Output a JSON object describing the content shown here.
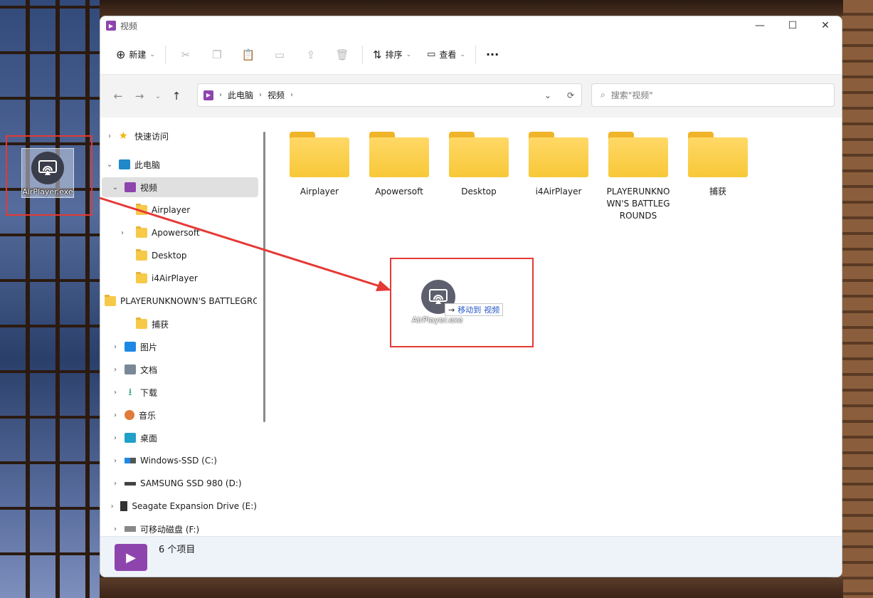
{
  "desktop": {
    "icon_label": "AirPlayer.exe"
  },
  "window": {
    "title": "视频",
    "min": "—",
    "max": "☐",
    "close": "✕"
  },
  "toolbar": {
    "new_label": "新建",
    "sort_label": "排序",
    "view_label": "查看",
    "more": "···"
  },
  "address": {
    "crumbs": [
      "此电脑",
      "视频"
    ],
    "search_placeholder": "搜索\"视频\""
  },
  "nav": {
    "quick_access": "快速访问",
    "this_pc": "此电脑",
    "videos": "视频",
    "children": [
      "Airplayer",
      "Apowersoft",
      "Desktop",
      "i4AirPlayer",
      "PLAYERUNKNOWN'S BATTLEGROUNDS",
      "捕获"
    ],
    "pictures": "图片",
    "documents": "文档",
    "downloads": "下载",
    "music": "音乐",
    "desktop": "桌面",
    "drive_c": "Windows-SSD (C:)",
    "drive_d": "SAMSUNG SSD 980 (D:)",
    "drive_e": "Seagate Expansion Drive (E:)",
    "drive_f": "可移动磁盘 (F:)"
  },
  "folders": [
    "Airplayer",
    "Apowersoft",
    "Desktop",
    "i4AirPlayer",
    "PLAYERUNKNOWN'S BATTLEGROUNDS",
    "捕获"
  ],
  "drag": {
    "file_label": "AirPlayer.exe",
    "action": "移动到",
    "target": "视频"
  },
  "status": {
    "count": "6 个项目"
  },
  "colors": {
    "accent": "#8e44ad",
    "highlight": "#e53935",
    "folder": "#f8c838"
  }
}
